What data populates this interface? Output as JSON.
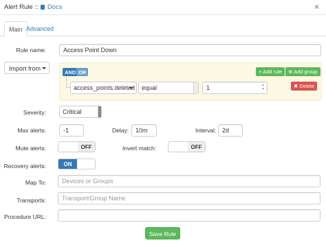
{
  "header": {
    "title": "Alert Rule ::",
    "docs_label": "Docs",
    "close_symbol": "×"
  },
  "tabs": [
    {
      "label": "Main",
      "active": true
    },
    {
      "label": "Advanced",
      "active": false
    }
  ],
  "rule_name": {
    "label": "Rule name:",
    "value": "Access Point Down"
  },
  "import_from": {
    "label": "Import from",
    "icon": "caret-down-icon"
  },
  "query_builder": {
    "and_label": "AND",
    "or_label": "OR",
    "add_rule_label": "Add rule",
    "add_group_label": "Add group",
    "field": "access_points.deleted",
    "operator": "equal",
    "value": "1",
    "delete_label": "Delete"
  },
  "severity": {
    "label": "Severity:",
    "value": "Critical"
  },
  "max_alerts": {
    "label": "Max alerts:",
    "value": "-1"
  },
  "delay": {
    "label": "Delay:",
    "value": "10m"
  },
  "interval": {
    "label": "Interval:",
    "value": "2d"
  },
  "mute_alerts": {
    "label": "Mute alerts:",
    "state": "OFF"
  },
  "invert_match": {
    "label": "Invert match:",
    "state": "OFF"
  },
  "recovery_alerts": {
    "label": "Recovery alerts:",
    "state": "ON"
  },
  "map_to": {
    "label": "Map To:",
    "placeholder": "Devices or Groups"
  },
  "transports": {
    "label": "Transports:",
    "placeholder": "Transport/Group Name"
  },
  "procedure_url": {
    "label": "Procedure URL:",
    "value": ""
  },
  "save_label": "Save Rule",
  "colors": {
    "primary": "#337ab7",
    "success": "#5cb85c",
    "danger": "#d9534f",
    "qb_background": "#fcf8e3"
  }
}
